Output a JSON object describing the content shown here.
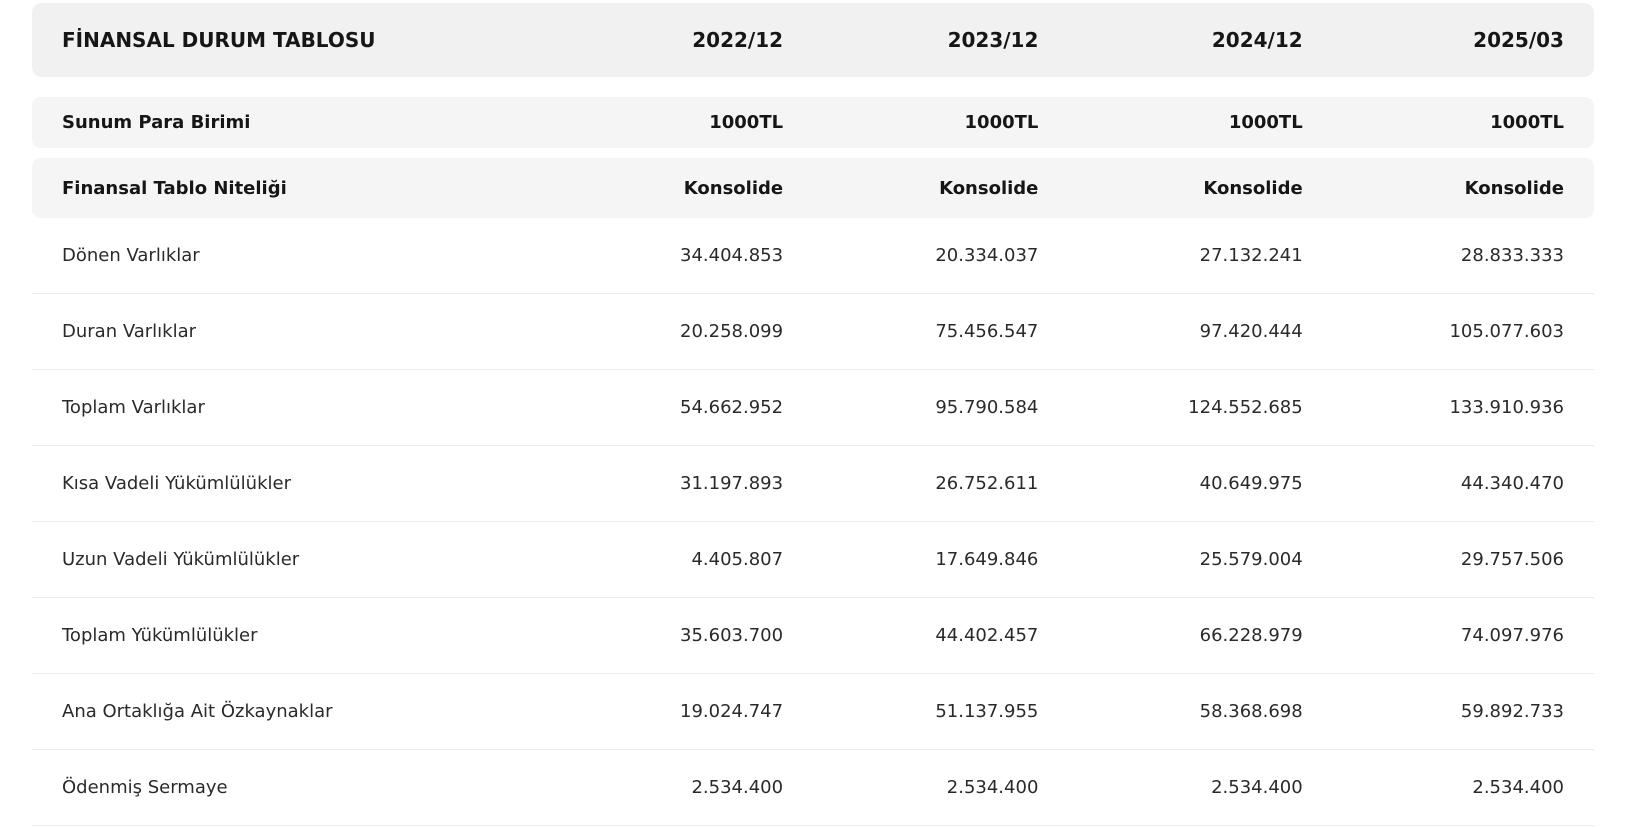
{
  "table": {
    "title": "FİNANSAL DURUM TABLOSU",
    "periods": [
      "2022/12",
      "2023/12",
      "2024/12",
      "2025/03"
    ],
    "currency": {
      "label": "Sunum Para Birimi",
      "values": [
        "1000TL",
        "1000TL",
        "1000TL",
        "1000TL"
      ]
    },
    "nature": {
      "label": "Finansal Tablo Niteliği",
      "values": [
        "Konsolide",
        "Konsolide",
        "Konsolide",
        "Konsolide"
      ]
    },
    "rows": [
      {
        "label": "Dönen Varlıklar",
        "values": [
          "34.404.853",
          "20.334.037",
          "27.132.241",
          "28.833.333"
        ]
      },
      {
        "label": "Duran Varlıklar",
        "values": [
          "20.258.099",
          "75.456.547",
          "97.420.444",
          "105.077.603"
        ]
      },
      {
        "label": "Toplam Varlıklar",
        "values": [
          "54.662.952",
          "95.790.584",
          "124.552.685",
          "133.910.936"
        ]
      },
      {
        "label": "Kısa Vadeli Yükümlülükler",
        "values": [
          "31.197.893",
          "26.752.611",
          "40.649.975",
          "44.340.470"
        ]
      },
      {
        "label": "Uzun Vadeli Yükümlülükler",
        "values": [
          "4.405.807",
          "17.649.846",
          "25.579.004",
          "29.757.506"
        ]
      },
      {
        "label": "Toplam Yükümlülükler",
        "values": [
          "35.603.700",
          "44.402.457",
          "66.228.979",
          "74.097.976"
        ]
      },
      {
        "label": "Ana Ortaklığa Ait Özkaynaklar",
        "values": [
          "19.024.747",
          "51.137.955",
          "58.368.698",
          "59.892.733"
        ]
      },
      {
        "label": "Ödenmiş Sermaye",
        "values": [
          "2.534.400",
          "2.534.400",
          "2.534.400",
          "2.534.400"
        ]
      }
    ]
  }
}
